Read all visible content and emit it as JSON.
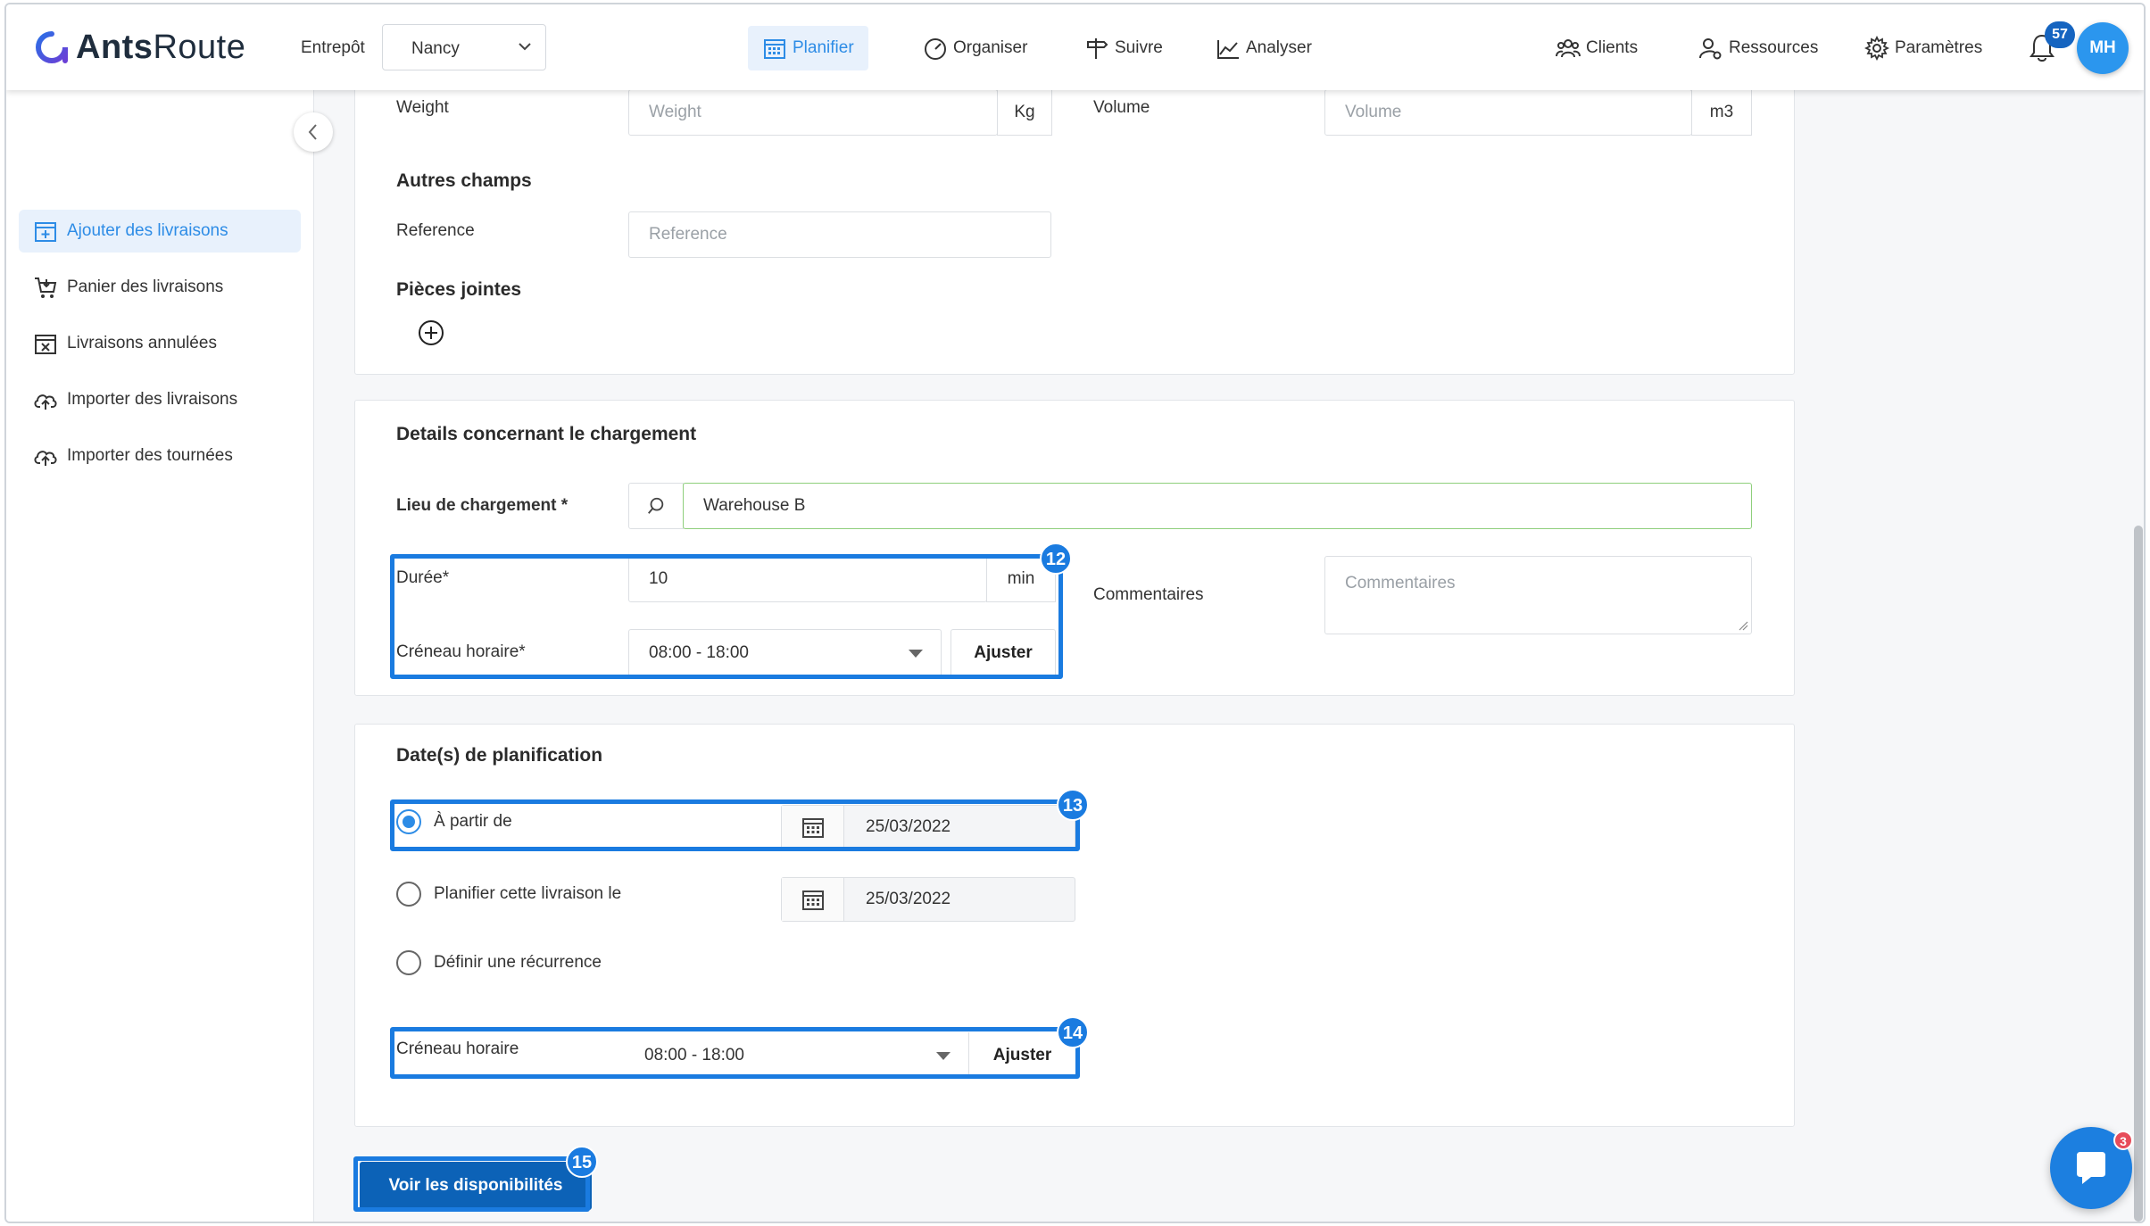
{
  "app": {
    "logo_text_bold": "Ants",
    "logo_text_light": "Route"
  },
  "header": {
    "entrepot_label": "Entrepôt",
    "entrepot_value": "Nancy",
    "nav": [
      {
        "label": "Planifier",
        "icon": "calendar-icon",
        "active": true
      },
      {
        "label": "Organiser",
        "icon": "gauge-icon",
        "active": false
      },
      {
        "label": "Suivre",
        "icon": "signpost-icon",
        "active": false
      },
      {
        "label": "Analyser",
        "icon": "chart-icon",
        "active": false
      }
    ],
    "right_nav": [
      {
        "label": "Clients",
        "icon": "users-icon"
      },
      {
        "label": "Ressources",
        "icon": "user-gear-icon"
      },
      {
        "label": "Paramètres",
        "icon": "gear-icon"
      }
    ],
    "notification_count": "57",
    "avatar_initials": "MH"
  },
  "sidebar": {
    "items": [
      {
        "label": "Ajouter des livraisons",
        "icon": "calendar-plus-icon",
        "active": true
      },
      {
        "label": "Panier des livraisons",
        "icon": "cart-icon",
        "active": false
      },
      {
        "label": "Livraisons annulées",
        "icon": "calendar-x-icon",
        "active": false
      },
      {
        "label": "Importer des livraisons",
        "icon": "cloud-upload-icon",
        "active": false
      },
      {
        "label": "Importer des tournées",
        "icon": "cloud-upload-icon",
        "active": false
      }
    ]
  },
  "card1": {
    "weight_label": "Weight",
    "weight_placeholder": "Weight",
    "weight_unit": "Kg",
    "volume_label": "Volume",
    "volume_placeholder": "Volume",
    "volume_unit": "m3",
    "autres_champs_title": "Autres champs",
    "reference_label": "Reference",
    "reference_placeholder": "Reference",
    "pieces_jointes_title": "Pièces jointes"
  },
  "card2": {
    "title": "Details concernant le chargement",
    "lieu_label": "Lieu de chargement *",
    "lieu_value": "Warehouse B",
    "duree_label": "Durée*",
    "duree_value": "10",
    "duree_unit": "min",
    "creneau_label": "Créneau horaire*",
    "creneau_value": "08:00 - 18:00",
    "ajuster_label": "Ajuster",
    "commentaires_label": "Commentaires",
    "commentaires_placeholder": "Commentaires"
  },
  "card3": {
    "title": "Date(s) de planification",
    "option_a_partir": "À partir de",
    "option_a_partir_date": "25/03/2022",
    "option_planifier": "Planifier cette livraison le",
    "option_planifier_date": "25/03/2022",
    "option_recurrence": "Définir une récurrence",
    "creneau_label": "Créneau horaire",
    "creneau_value": "08:00 - 18:00",
    "ajuster_label": "Ajuster"
  },
  "primary_button": "Voir les disponibilités",
  "steps": {
    "s12": "12",
    "s13": "13",
    "s14": "14",
    "s15": "15"
  },
  "chat_badge": "3",
  "colors": {
    "accent": "#2d8ce6",
    "highlight": "#1a7be0",
    "primary_button": "#0c62b7",
    "lieu_border": "#8fcf7c"
  }
}
